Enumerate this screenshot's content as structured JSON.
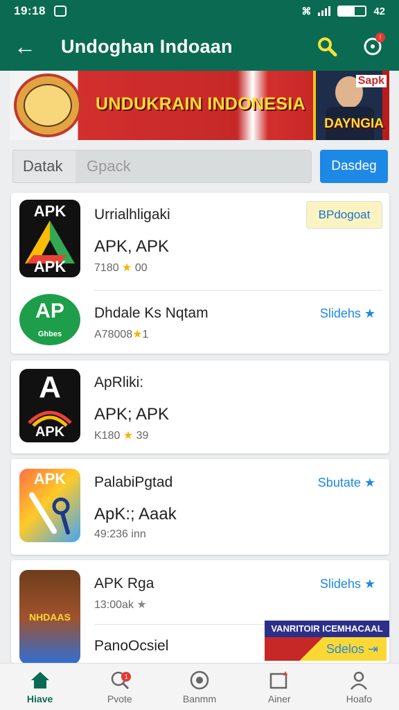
{
  "status_bar": {
    "time": "19:18",
    "battery": "42"
  },
  "header": {
    "title": "Undoghan Indoaan"
  },
  "banner": {
    "title": "UNDUKRAIN INDONESIA",
    "corner_text": "Sapk",
    "sub_text": "DAYNGIA"
  },
  "filter": {
    "label": "Datak",
    "placeholder": "Gpack",
    "button_label": "Dasdeg"
  },
  "apps": [
    {
      "name": "Urrialhligaki",
      "subtitle": "APK, APK",
      "meta": "7180",
      "meta_after": "00",
      "action": "BPdogoat",
      "icon_text_top": "APK",
      "icon_text_bottom": "APK"
    },
    {
      "name": "Dhdale Ks Nqtam",
      "meta": "A78008",
      "meta_after": "1",
      "action": "Slidehs",
      "icon_text_top": "AP",
      "icon_text_bottom": "Ghbes"
    },
    {
      "name": "ApRliki:",
      "subtitle": "APK; APK",
      "meta": "K180",
      "meta_after": "39",
      "icon_text_top": "A",
      "icon_text_bottom": "APK"
    },
    {
      "name": "PalabiPgtad",
      "subtitle": "ApK:; Aaak",
      "meta": "49:236 inn",
      "action": "Sbutate",
      "icon_text_top": "APK"
    },
    {
      "name": "APK Rga",
      "meta": "13:00ak",
      "action": "Slidehs",
      "icon_text_top": "NHDAAS"
    },
    {
      "name": "PanoOcsiel",
      "action": "Sdelos"
    }
  ],
  "promo_text": "VANRITOIR ICEMHACAAL",
  "nav": [
    {
      "label": "Hiave",
      "active": true
    },
    {
      "label": "Pvote",
      "badge": "1"
    },
    {
      "label": "Banmm"
    },
    {
      "label": "Ainer"
    },
    {
      "label": "Hoafo"
    }
  ],
  "colors": {
    "primary": "#0b6b52",
    "accent": "#1e88e5",
    "star": "#f5b301",
    "badge": "#e53935"
  }
}
